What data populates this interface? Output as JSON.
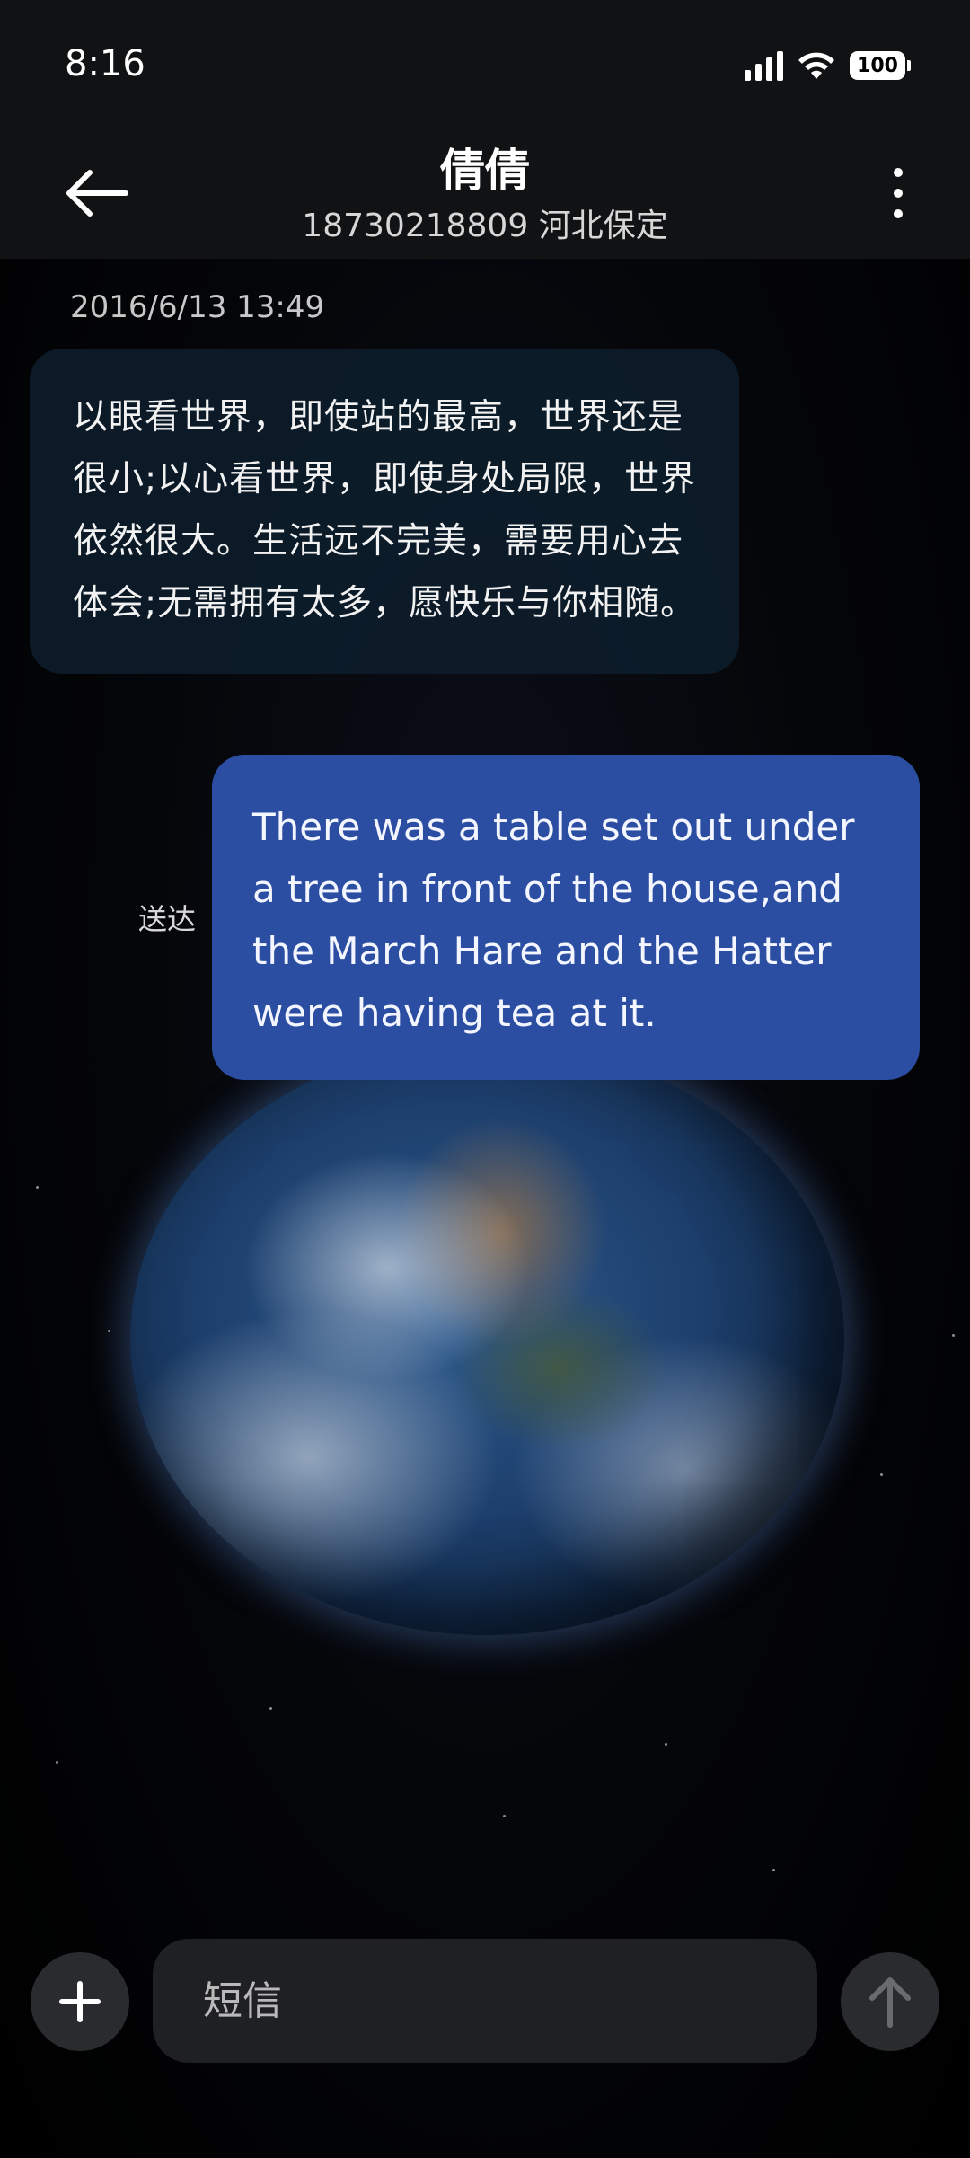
{
  "status_bar": {
    "time": "8:16",
    "battery": "100"
  },
  "header": {
    "title": "倩倩",
    "subtitle": "18730218809 河北保定",
    "back_icon": "arrow-left-icon",
    "more_icon": "more-vertical-icon"
  },
  "conversation": {
    "timestamp": "2016/6/13 13:49",
    "messages": [
      {
        "direction": "incoming",
        "text": "以眼看世界，即使站的最高，世界还是很小;以心看世界，即使身处局限，世界依然很大。生活远不完美，需要用心去体会;无需拥有太多，愿快乐与你相随。"
      },
      {
        "direction": "outgoing",
        "text": "There was a table set out under a tree in front of the house,and the March Hare and the Hatter were having tea at it.",
        "status": "送达"
      }
    ]
  },
  "composer": {
    "placeholder": "短信",
    "add_icon": "plus-icon",
    "send_icon": "arrow-up-icon"
  },
  "colors": {
    "outgoing_bubble": "#2b4ea3",
    "incoming_bubble": "#0e1e2c",
    "header_bg": "#111214"
  }
}
